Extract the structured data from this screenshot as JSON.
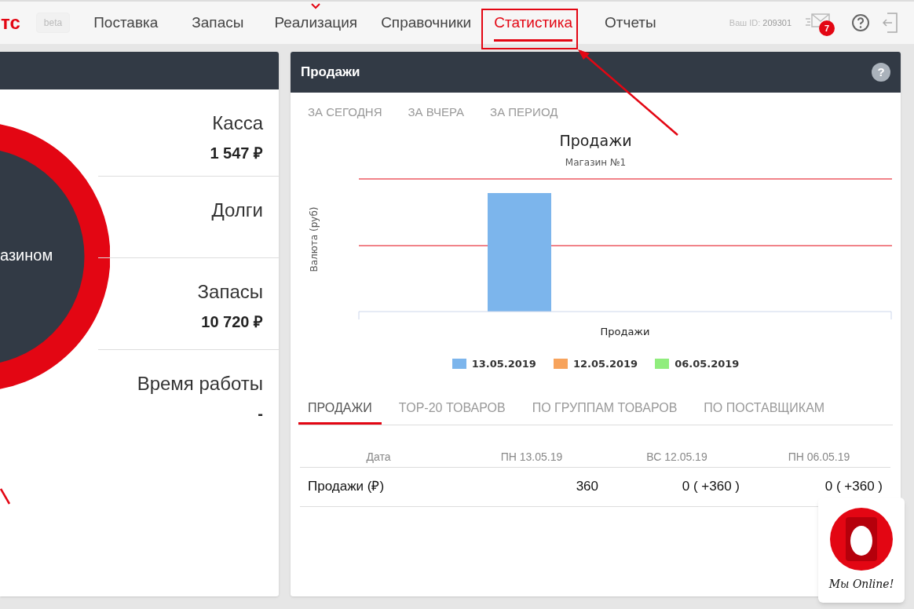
{
  "logo": "тс",
  "badge": "beta",
  "nav": [
    {
      "label": "Поставка",
      "selected": false,
      "flagged": false
    },
    {
      "label": "Запасы",
      "selected": false,
      "flagged": false
    },
    {
      "label": "Реализация",
      "selected": false,
      "flagged": true
    },
    {
      "label": "Справочники",
      "selected": false,
      "flagged": false
    },
    {
      "label": "Статистика",
      "selected": true,
      "flagged": false
    },
    {
      "label": "Отчеты",
      "selected": false,
      "flagged": false
    }
  ],
  "user_id_label": "Ваш ID:",
  "user_id": "209301",
  "messages_count": "7",
  "left_panel": {
    "circle_text": "азином",
    "stats": [
      {
        "label": "Касса",
        "value": "1 547 ₽"
      },
      {
        "label": "Долги"
      },
      {
        "label": "Запасы",
        "value": "10 720 ₽"
      },
      {
        "label": "Время работы",
        "value": "-"
      }
    ]
  },
  "sales_panel": {
    "title": "Продажи",
    "help": "?",
    "periods": [
      "ЗА СЕГОДНЯ",
      "ЗА ВЧЕРА",
      "ЗА ПЕРИОД"
    ],
    "chart": {
      "title": "Продажи",
      "subtitle": "Магазин №1",
      "ylabel": "Валюта (руб)",
      "xlabel": "Продажи",
      "legend": [
        {
          "label": "13.05.2019",
          "color": "#7cb5ec"
        },
        {
          "label": "12.05.2019",
          "color": "#f7a35c"
        },
        {
          "label": "06.05.2019",
          "color": "#90ed7d"
        }
      ]
    },
    "tabs": [
      {
        "label": "ПРОДАЖИ",
        "selected": true
      },
      {
        "label": "TOP-20 ТОВАРОВ",
        "selected": false
      },
      {
        "label": "ПО ГРУППАМ ТОВАРОВ",
        "selected": false
      },
      {
        "label": "ПО ПОСТАВЩИКАМ",
        "selected": false
      }
    ],
    "table": {
      "columns": [
        "Дата",
        "ПН 13.05.19",
        "ВС 12.05.19",
        "ПН 06.05.19"
      ],
      "rows": [
        [
          "Продажи (₽)",
          "360",
          "0 ( +360 )",
          "0 ( +360 )"
        ]
      ]
    }
  },
  "chat_widget": {
    "label": "Мы Online!"
  }
}
